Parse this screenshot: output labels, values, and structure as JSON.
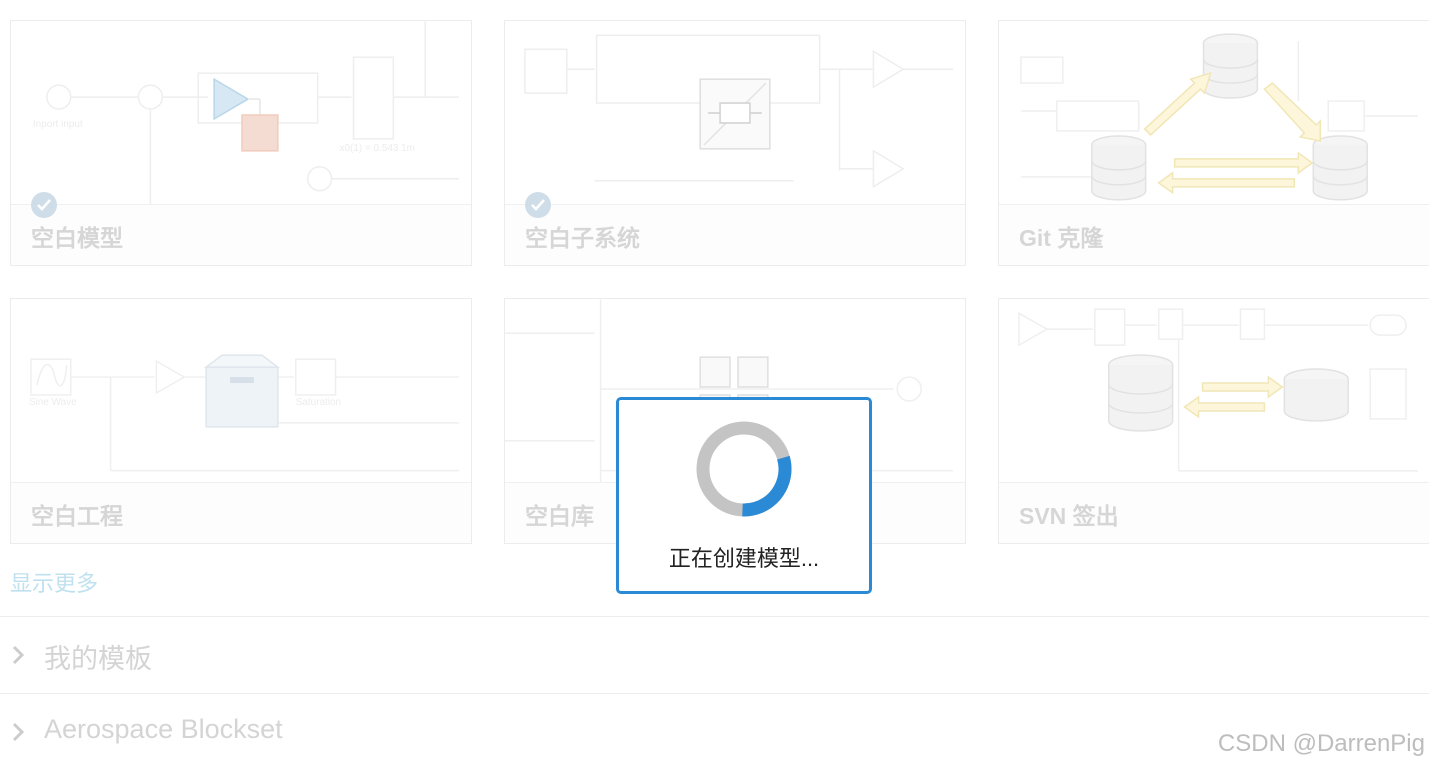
{
  "templates": [
    {
      "label": "空白模型",
      "checked": true
    },
    {
      "label": "空白子系统",
      "checked": true
    },
    {
      "label": "Git 克隆",
      "checked": false
    },
    {
      "label": "空白工程",
      "checked": false
    },
    {
      "label": "空白库",
      "checked": false
    },
    {
      "label": "SVN 签出",
      "checked": false
    }
  ],
  "show_more_label": "显示更多",
  "sections": [
    {
      "title": "我的模板"
    },
    {
      "title": "Aerospace Blockset"
    }
  ],
  "loading": {
    "message": "正在创建模型...",
    "progress_fraction": 0.3
  },
  "watermark": "CSDN @DarrenPig",
  "colors": {
    "accent": "#2b8ad6",
    "spinner_track": "#c4c4c4",
    "faded_label": "#d6d6d6"
  }
}
